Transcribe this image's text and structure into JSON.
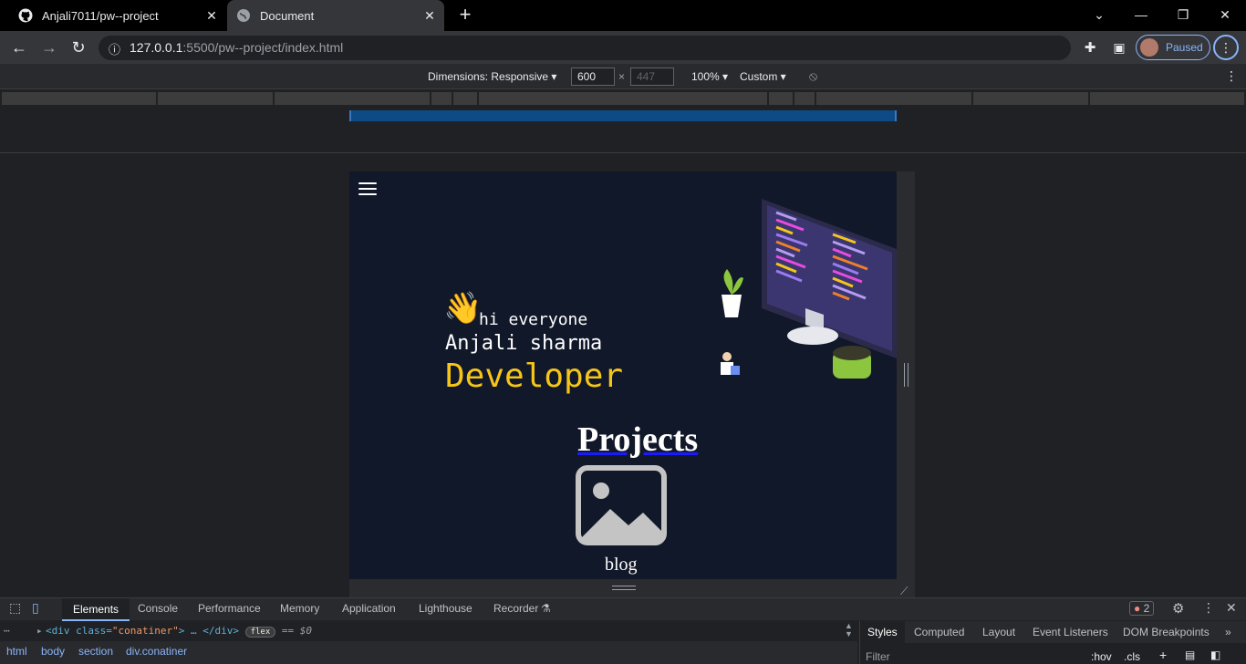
{
  "browser": {
    "tabs": [
      {
        "title": "Anjali7011/pw--project",
        "icon": "github-icon"
      },
      {
        "title": "Document",
        "icon": "globe-icon"
      }
    ],
    "new_tab": "+",
    "url_host": "127.0.0.1",
    "url_rest": ":5500/pw--project/index.html",
    "profile_label": "Paused"
  },
  "device_toolbar": {
    "dimensions_label": "Dimensions: Responsive",
    "width": "600",
    "height_placeholder": "447",
    "times": "×",
    "zoom": "100%",
    "throttle": "Custom"
  },
  "page": {
    "greeting": "hi everyone",
    "wave_emoji": "👋",
    "name": "Anjali sharma",
    "role": "Developer",
    "projects_heading": "Projects",
    "blog_label": "blog",
    "colors": {
      "background": "#111829",
      "role": "#f5c518"
    }
  },
  "devtools": {
    "tabs": [
      "Elements",
      "Console",
      "Performance",
      "Memory",
      "Application",
      "Lighthouse",
      "Recorder"
    ],
    "active_tab": "Elements",
    "error_count": "2",
    "dom_line": {
      "open": "<div class=",
      "class_value": "\"conatiner\"",
      "close": "> … </div>",
      "badge": "flex",
      "eq": "== $0"
    },
    "breadcrumbs": [
      "html",
      "body",
      "section",
      "div.conatiner"
    ],
    "side_tabs": [
      "Styles",
      "Computed",
      "Layout",
      "Event Listeners",
      "DOM Breakpoints"
    ],
    "side_active": "Styles",
    "filter_placeholder": "Filter",
    "hov": ":hov",
    "cls": ".cls"
  }
}
